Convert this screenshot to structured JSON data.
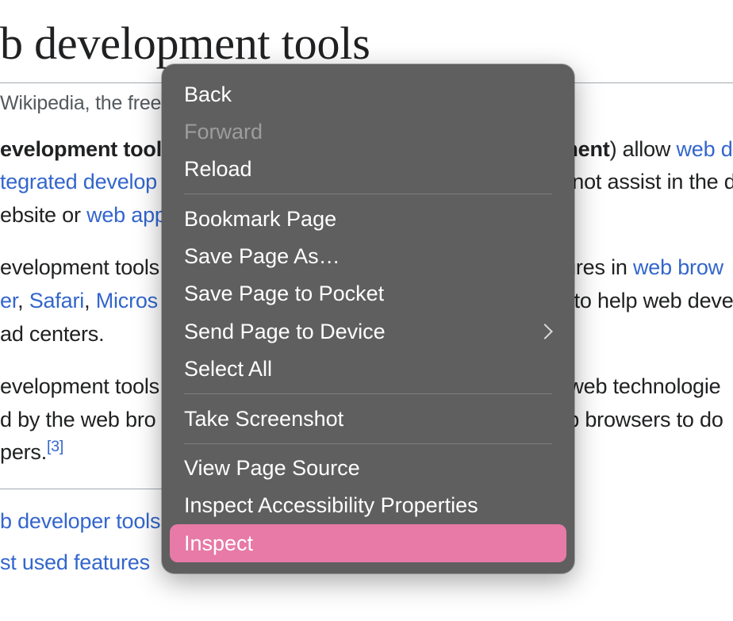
{
  "page": {
    "title_fragment": "b development tools",
    "subtitle_fragment": "Wikipedia, the free ",
    "para1": {
      "lead_bold": "evelopment tools",
      "allow_text": ") allow ",
      "web_link_frag": "web d",
      "integrated_link_frag": "tegrated develop",
      "not_assist_frag": " not assist in the d",
      "website_or": "ebsite or ",
      "web_app_link_frag": "web app"
    },
    "para2": {
      "line1_lead": "evelopment tools",
      "features_in": "atures in ",
      "web_brow_link_frag": "web brow",
      "er_text": "er",
      "comma1": ", ",
      "safari_link": "Safari",
      "comma2": ", ",
      "micros_link_frag": "Micros",
      "help_dev_frag": "s to help web deve",
      "load_centers": "ad centers."
    },
    "para3": {
      "line1_lead": "evelopment tools",
      "of_tech_frag": "of web technologie",
      "by_browser_lead": "d by the web bro",
      "eb_browsers_do_frag": "eb browsers to do",
      "pers": "pers.",
      "ref": "[3]"
    },
    "toc": {
      "item1": "b developer tools support",
      "item2": "st used features"
    }
  },
  "menu": {
    "back": "Back",
    "forward": "Forward",
    "reload": "Reload",
    "bookmark": "Bookmark Page",
    "save_as": "Save Page As…",
    "save_pocket": "Save Page to Pocket",
    "send_device": "Send Page to Device",
    "select_all": "Select All",
    "screenshot": "Take Screenshot",
    "view_source": "View Page Source",
    "inspect_a11y": "Inspect Accessibility Properties",
    "inspect": "Inspect"
  },
  "colors": {
    "link": "#3366cc",
    "menu_bg": "#5f5f5f",
    "highlight": "#e77aa7"
  }
}
